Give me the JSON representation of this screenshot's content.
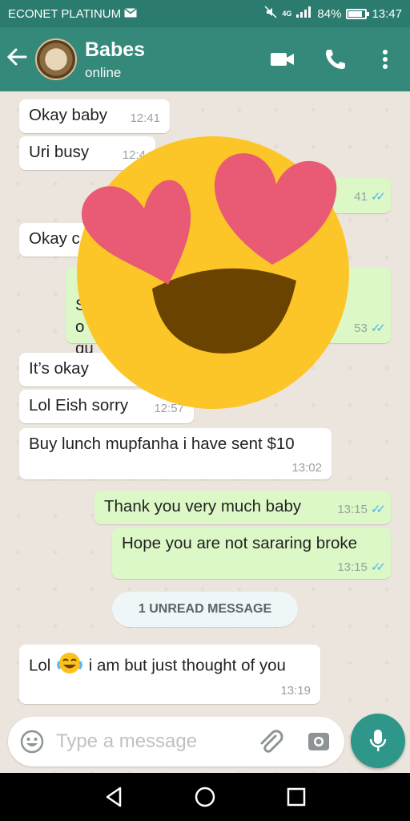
{
  "status_bar": {
    "carrier": "ECONET PLATINUM",
    "network": "4G",
    "battery": "84%",
    "battery_level": 0.84,
    "time": "13:47"
  },
  "header": {
    "contact_name": "Babes",
    "contact_status": "online",
    "icons": [
      "back-arrow-icon",
      "video-call-icon",
      "voice-call-icon",
      "more-vert-icon"
    ]
  },
  "messages": [
    {
      "dir": "in",
      "text": "Okay baby",
      "time": "12:41"
    },
    {
      "dir": "in",
      "text": "Uri busy",
      "time": "12:4"
    },
    {
      "dir": "out",
      "text": "",
      "time": "41"
    },
    {
      "dir": "in",
      "text": "Okay c",
      "time": ""
    },
    {
      "dir": "out",
      "text": "S\no\nqu",
      "time": "53"
    },
    {
      "dir": "in",
      "text": "It’s okay",
      "time": "12:"
    },
    {
      "dir": "in",
      "text": "Lol Eish sorry",
      "time": "12:57"
    },
    {
      "dir": "in",
      "text": "Buy lunch mupfanha i have sent $10",
      "time": "13:02"
    },
    {
      "dir": "out",
      "text": "Thank you very much baby",
      "time": "13:15"
    },
    {
      "dir": "out",
      "text": "Hope you are not sararing broke",
      "time": "13:15"
    },
    {
      "dir": "in",
      "text_before": "Lol",
      "text_after": "i am but just thought of you",
      "emoji": "tears-of-joy-emoji",
      "time": "13:19"
    }
  ],
  "unread_label": "1 UNREAD MESSAGE",
  "input": {
    "placeholder": "Type a message"
  },
  "overlay": {
    "emoji": "heart-eyes-emoji"
  },
  "colors": {
    "header": "#34897a",
    "status_bar": "#2b7b6f",
    "outgoing": "#dcf8c6",
    "incoming": "#ffffff",
    "read_ticks": "#4fb6ec",
    "send_button": "#2f978a"
  }
}
